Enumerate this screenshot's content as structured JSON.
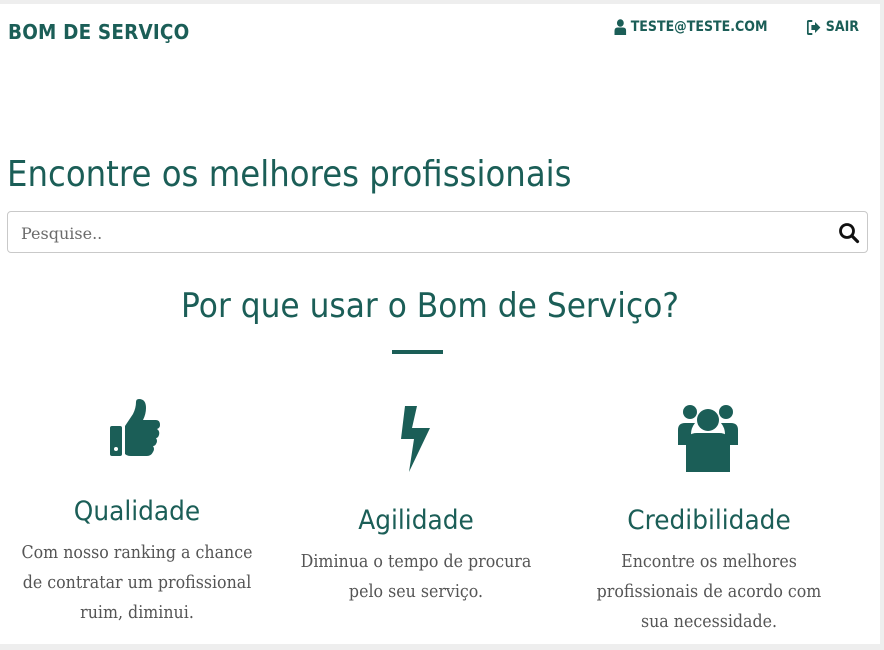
{
  "header": {
    "brand": "BOM DE SERVIÇO",
    "user_email": "TESTE@TESTE.COM",
    "logout_label": "SAIR"
  },
  "hero": {
    "title": "Encontre os melhores profissionais",
    "search_placeholder": "Pesquise.."
  },
  "why": {
    "title": "Por que usar o Bom de Serviço?",
    "features": [
      {
        "icon": "thumbs-up-icon",
        "title": "Qualidade",
        "description": "Com nosso ranking a chance de contratar um profissional ruim, diminui."
      },
      {
        "icon": "lightning-bolt-icon",
        "title": "Agilidade",
        "description": "Diminua o tempo de procura pelo seu serviço."
      },
      {
        "icon": "users-icon",
        "title": "Credibilidade",
        "description": "Encontre os melhores profissionais de acordo com sua necessidade."
      }
    ]
  },
  "colors": {
    "primary": "#1b5e57",
    "text_muted": "#555555",
    "background": "#ffffff"
  }
}
